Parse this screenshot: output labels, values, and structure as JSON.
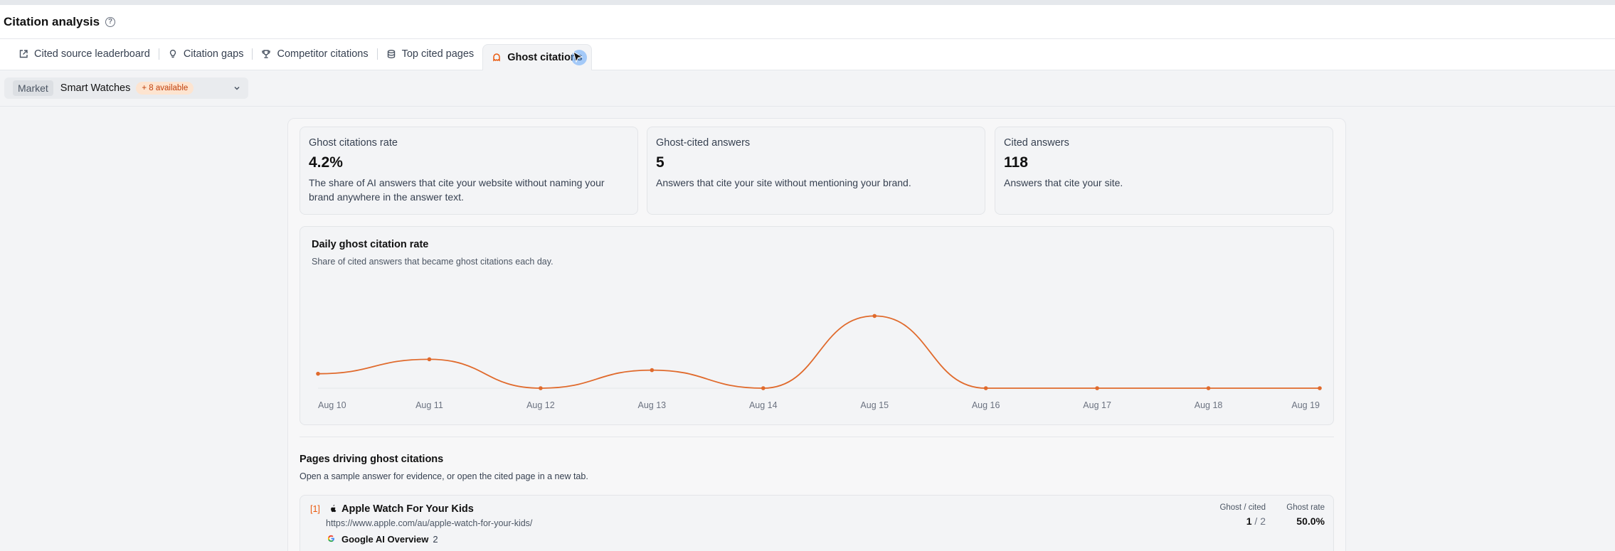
{
  "header": {
    "title": "Citation analysis",
    "help_icon": "question-circle-icon"
  },
  "tabs": [
    {
      "label": "Cited source leaderboard",
      "icon": "external-link-icon",
      "active": false
    },
    {
      "label": "Citation gaps",
      "icon": "lightbulb-icon",
      "active": false
    },
    {
      "label": "Competitor citations",
      "icon": "trophy-icon",
      "active": false
    },
    {
      "label": "Top cited pages",
      "icon": "database-icon",
      "active": false
    },
    {
      "label": "Ghost citations",
      "icon": "ghost-bell-icon",
      "active": true
    }
  ],
  "filter": {
    "label": "Market",
    "value": "Smart Watches",
    "badge": "+ 8 available"
  },
  "metrics": [
    {
      "label": "Ghost citations rate",
      "value": "4.2%",
      "desc": "The share of AI answers that cite your website without naming your brand anywhere in the answer text."
    },
    {
      "label": "Ghost-cited answers",
      "value": "5",
      "desc": "Answers that cite your site without mentioning your brand."
    },
    {
      "label": "Cited answers",
      "value": "118",
      "desc": "Answers that cite your site."
    }
  ],
  "chart": {
    "title": "Daily ghost citation rate",
    "subtitle": "Share of cited answers that became ghost citations each day."
  },
  "chart_data": {
    "type": "line",
    "title": "Daily ghost citation rate",
    "categories": [
      "Aug 10",
      "Aug 11",
      "Aug 12",
      "Aug 13",
      "Aug 14",
      "Aug 15",
      "Aug 16",
      "Aug 17",
      "Aug 18",
      "Aug 19"
    ],
    "series": [
      {
        "values": [
          4,
          8,
          0,
          5,
          0,
          20,
          0,
          0,
          0,
          0
        ]
      }
    ],
    "ylim": [
      0,
      100
    ],
    "grid": false,
    "color": "#e06a2c"
  },
  "pages": {
    "title": "Pages driving ghost citations",
    "subtitle": "Open a sample answer for evidence, or open the cited page in a new tab.",
    "col_ghost": "Ghost / cited",
    "col_rate": "Ghost rate",
    "rows": [
      {
        "index": "[1]",
        "title": "Apple Watch For Your Kids",
        "url": "https://www.apple.com/au/apple-watch-for-your-kids/",
        "engine": "Google AI Overview",
        "engine_count": "2",
        "ghost": "1",
        "sep": "/",
        "cited": "2",
        "rate": "50.0%"
      }
    ]
  }
}
